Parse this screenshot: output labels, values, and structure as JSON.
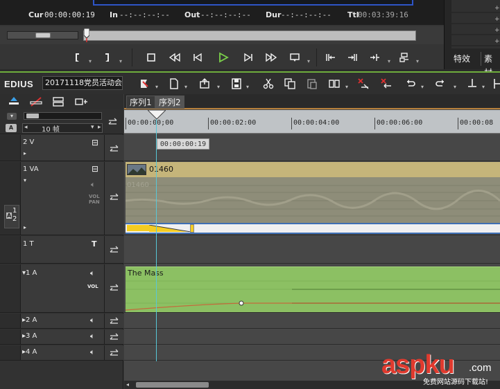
{
  "player": {
    "cur_label": "Cur",
    "cur_value": "00:00:00:19",
    "in_label": "In",
    "in_value": "--:--:--:--",
    "out_label": "Out",
    "out_value": "--:--:--:--",
    "dur_label": "Dur",
    "dur_value": "--:--:--:--",
    "ttl_label": "Ttl",
    "ttl_value": "00:03:39:16",
    "colors": {
      "timecode": "#e8e8e8",
      "ttl": "#a8a8a8",
      "play": "#7bd14a",
      "frame": "#2e55c8"
    }
  },
  "right_panel": {
    "tabs": [
      "特效",
      "素材"
    ]
  },
  "timeline": {
    "app_logo": "EDIUS",
    "project_name": "20171118党员活动会",
    "accent_color": "#6fae3c",
    "sequence_tabs": [
      "序列1",
      "序列2"
    ],
    "zoom_label": "10 帧",
    "ruler_marks": [
      "00:00:00;00",
      "00:00:02:00",
      "00:00:04:00",
      "00:00:06:00",
      "00:00:08"
    ],
    "playhead_tooltip": "00:00:00:19",
    "tracks": [
      {
        "label": "2 V",
        "type": "video"
      },
      {
        "label": "1 VA",
        "type": "video-audio",
        "vol_label_1": "VOL",
        "vol_label_2": "PAN",
        "side_label": "1",
        "side_sub": "2"
      },
      {
        "label": "1 T",
        "type": "title"
      },
      {
        "label": "▾1 A",
        "type": "audio",
        "vol_label": "VOL"
      },
      {
        "label": "▸2 A",
        "type": "audio"
      },
      {
        "label": "▸3 A",
        "type": "audio"
      },
      {
        "label": "▸4 A",
        "type": "audio"
      }
    ],
    "clips": {
      "video_clip_name": "01460",
      "video_clip_ghost": "01460",
      "audio_clip_name": "The Mass"
    }
  },
  "watermark": {
    "logo": "aspku",
    "tld": ".com",
    "subtitle": "免费网站源码下载站!"
  }
}
